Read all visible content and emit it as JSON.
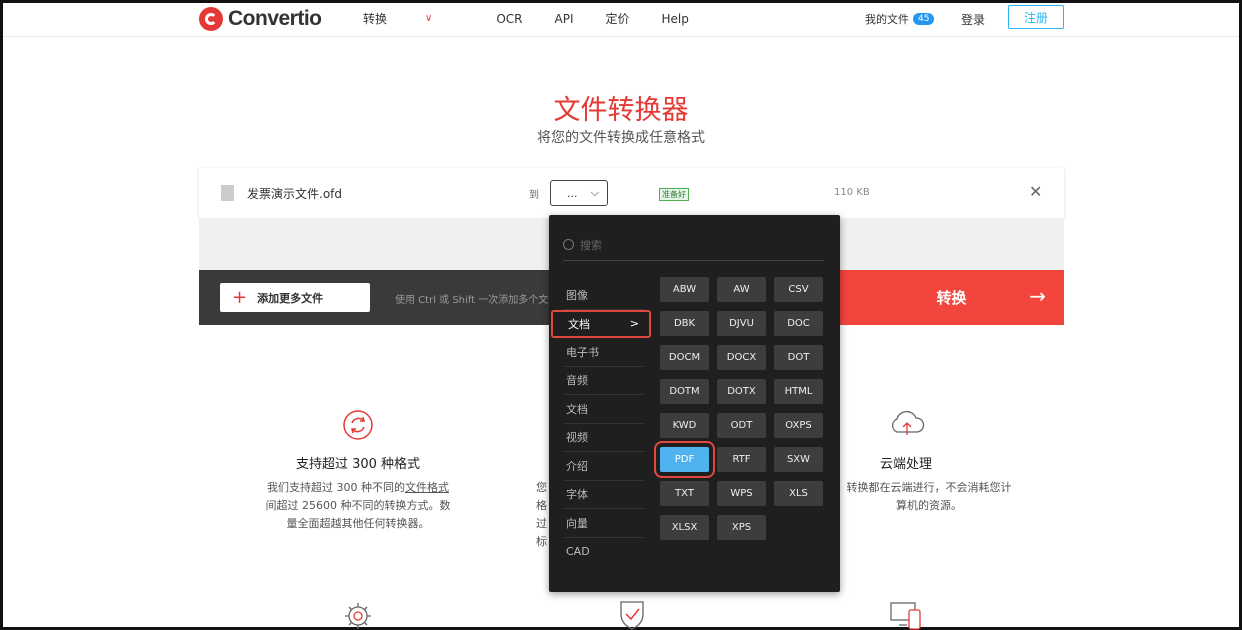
{
  "header": {
    "logo_text": "Convertio",
    "nav": [
      "转换",
      "OCR",
      "API",
      "定价",
      "Help"
    ],
    "my_files_label": "我的文件",
    "my_files_count": "45",
    "login": "登录",
    "register": "注册"
  },
  "hero": {
    "title": "文件转换器",
    "subtitle": "将您的文件转换成任意格式"
  },
  "file": {
    "name": "发票演示文件.ofd",
    "to_label": "到",
    "selected_format": "...",
    "status": "准备好",
    "size": "110 KB"
  },
  "actions": {
    "add_more": "添加更多文件",
    "hint": "使用 Ctrl 或 Shift 一次添加多个文件",
    "convert": "转换"
  },
  "features": [
    {
      "title": "支持超过 300 种格式",
      "line1_pre": "我们支持超过 300 种不同的",
      "line1_link": "文件格式",
      "line2": "间超过 25600 种不同的转换方式。数",
      "line3": "量全面超越其他任何转换器。"
    },
    {
      "title": "云端处理",
      "line1": "转换都在云端进行，不会消耗您计",
      "line2": "算机的资源。"
    }
  ],
  "hidden_partial": [
    "您",
    "格",
    "过",
    "标"
  ],
  "dropdown": {
    "search_placeholder": "搜索",
    "categories": [
      "图像",
      "文档",
      "电子书",
      "音频",
      "文档",
      "视频",
      "介绍",
      "字体",
      "向量",
      "CAD"
    ],
    "formats": [
      "ABW",
      "AW",
      "CSV",
      "DBK",
      "DJVU",
      "DOC",
      "DOCM",
      "DOCX",
      "DOT",
      "DOTM",
      "DOTX",
      "HTML",
      "KWD",
      "ODT",
      "OXPS",
      "PDF",
      "RTF",
      "SXW",
      "TXT",
      "WPS",
      "XLS",
      "XLSX",
      "XPS"
    ],
    "selected_format": "PDF"
  },
  "colors": {
    "brand": "#e53935",
    "accent": "#4fb3f0"
  }
}
